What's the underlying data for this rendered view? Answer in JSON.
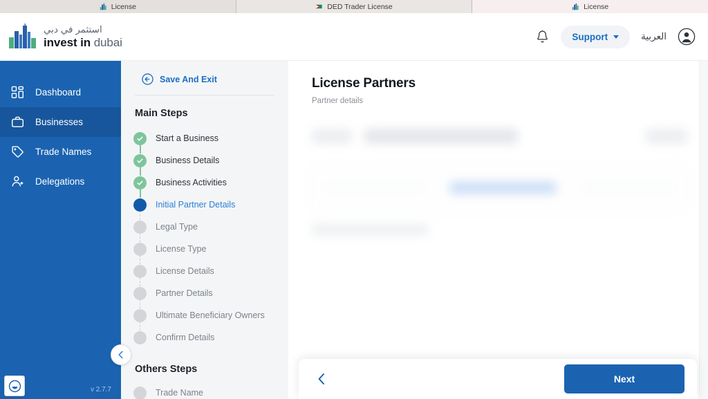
{
  "browser": {
    "tabs": [
      {
        "label": "License",
        "favicon": "dubai-buildings-icon",
        "active": false
      },
      {
        "label": "DED Trader License",
        "favicon": "ded-flag-icon",
        "active": false
      },
      {
        "label": "License",
        "favicon": "dubai-buildings-icon",
        "active": true
      }
    ]
  },
  "header": {
    "brand": {
      "arabic": "استثمر في دبي",
      "english_bold": "invest in",
      "english_light": "dubai",
      "logo": "invest-in-dubai-logo"
    },
    "notifications_icon": "bell-icon",
    "support_label": "Support",
    "support_caret": "chevron-down-icon",
    "language_label": "العربية",
    "avatar_icon": "user-avatar-icon"
  },
  "sidebar": {
    "items": [
      {
        "label": "Dashboard",
        "icon": "grid-icon",
        "active": false
      },
      {
        "label": "Businesses",
        "icon": "briefcase-icon",
        "active": true
      },
      {
        "label": "Trade Names",
        "icon": "tag-icon",
        "active": false
      },
      {
        "label": "Delegations",
        "icon": "person-add-icon",
        "active": false
      }
    ],
    "version": "v 2.7.7",
    "feedback_icon": "smiley-face-icon",
    "collapse_icon": "chevron-left-icon"
  },
  "steps_panel": {
    "save_and_exit": "Save And Exit",
    "save_and_exit_icon": "arrow-left-circle-icon",
    "main_heading": "Main Steps",
    "main_steps": [
      {
        "label": "Start a Business",
        "state": "done"
      },
      {
        "label": "Business Details",
        "state": "done"
      },
      {
        "label": "Business Activities",
        "state": "done"
      },
      {
        "label": "Initial Partner Details",
        "state": "current"
      },
      {
        "label": "Legal Type",
        "state": "todo"
      },
      {
        "label": "License Type",
        "state": "todo"
      },
      {
        "label": "License Details",
        "state": "todo"
      },
      {
        "label": "Partner Details",
        "state": "todo"
      },
      {
        "label": "Ultimate Beneficiary Owners",
        "state": "todo"
      },
      {
        "label": "Confirm Details",
        "state": "todo"
      }
    ],
    "others_heading": "Others Steps",
    "other_steps": [
      {
        "label": "Trade Name",
        "state": "todo"
      }
    ]
  },
  "main": {
    "title": "License Partners",
    "subtitle": "Partner details"
  },
  "actionbar": {
    "back_icon": "chevron-left-icon",
    "next_label": "Next"
  },
  "colors": {
    "brand_blue": "#1b63b1",
    "active_nav_blue": "#17569c",
    "link_blue": "#1b6ec2",
    "step_done_green": "#7ec59b",
    "step_current_blue": "#115aa8",
    "step_todo_gray": "#d3d5d8",
    "panel_bg": "#f4f5f7"
  }
}
